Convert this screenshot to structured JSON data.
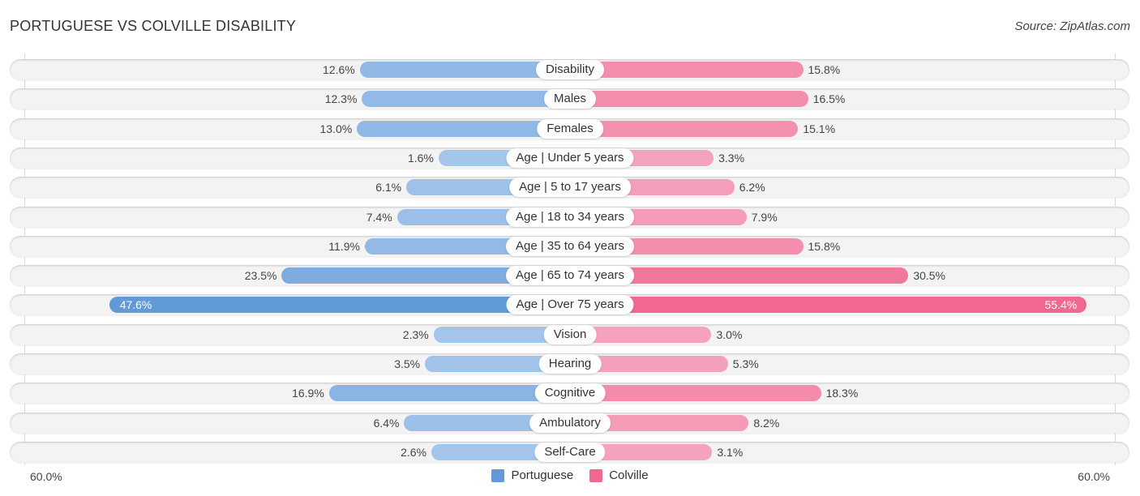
{
  "header": {
    "title": "PORTUGUESE VS COLVILLE DISABILITY",
    "source": "Source: ZipAtlas.com"
  },
  "colors": {
    "portuguese_light": "#a8c8ec",
    "portuguese_strong": "#6199d9",
    "colville_light": "#f5a8c0",
    "colville_strong": "#f06890"
  },
  "chart_data": {
    "type": "bar",
    "orientation": "horizontal-diverging",
    "title": "PORTUGUESE VS COLVILLE DISABILITY",
    "categories": [
      "Disability",
      "Males",
      "Females",
      "Age | Under 5 years",
      "Age | 5 to 17 years",
      "Age | 18 to 34 years",
      "Age | 35 to 64 years",
      "Age | 65 to 74 years",
      "Age | Over 75 years",
      "Vision",
      "Hearing",
      "Cognitive",
      "Ambulatory",
      "Self-Care"
    ],
    "series": [
      {
        "name": "Portuguese",
        "side": "left",
        "values": [
          12.6,
          12.3,
          13.0,
          1.6,
          6.1,
          7.4,
          11.9,
          23.5,
          47.6,
          2.3,
          3.5,
          16.9,
          6.4,
          2.6
        ],
        "labels": [
          "12.6%",
          "12.3%",
          "13.0%",
          "1.6%",
          "6.1%",
          "7.4%",
          "11.9%",
          "23.5%",
          "47.6%",
          "2.3%",
          "3.5%",
          "16.9%",
          "6.4%",
          "2.6%"
        ]
      },
      {
        "name": "Colville",
        "side": "right",
        "values": [
          15.8,
          16.5,
          15.1,
          3.3,
          6.2,
          7.9,
          15.8,
          30.5,
          55.4,
          3.0,
          5.3,
          18.3,
          8.2,
          3.1
        ],
        "labels": [
          "15.8%",
          "16.5%",
          "15.1%",
          "3.3%",
          "6.2%",
          "7.9%",
          "15.8%",
          "30.5%",
          "55.4%",
          "3.0%",
          "5.3%",
          "18.3%",
          "8.2%",
          "3.1%"
        ]
      }
    ],
    "xlim": [
      -60,
      60
    ],
    "axis_labels": {
      "left": "60.0%",
      "right": "60.0%"
    },
    "legend": {
      "position": "bottom-center",
      "entries": [
        "Portuguese",
        "Colville"
      ]
    },
    "grid": false
  }
}
